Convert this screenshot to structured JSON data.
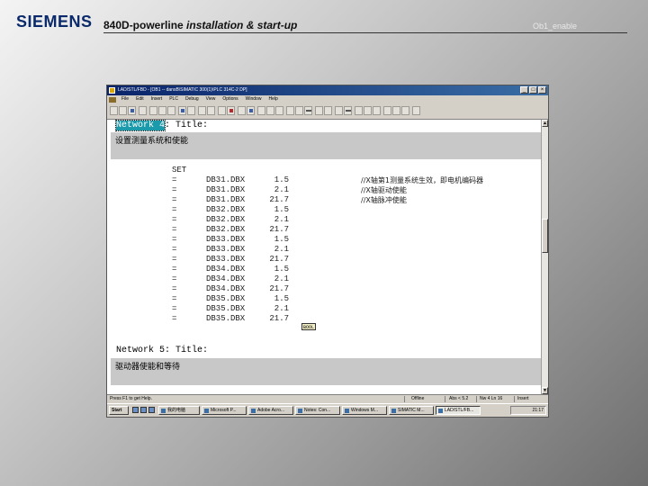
{
  "slide": {
    "logo": "SIEMENS",
    "title_plain": "840D-powerline ",
    "title_italic": "installation & start-up",
    "header_right": "Ob1_enable"
  },
  "window": {
    "title": "LAD/STL/FBD - [OB1 -- dansB\\SIMATIC 300(1)\\PLC 314C-2 DP]",
    "controls": [
      "_",
      "□",
      "×"
    ]
  },
  "menu": [
    "File",
    "Edit",
    "Insert",
    "PLC",
    "Debug",
    "View",
    "Options",
    "Window",
    "Help"
  ],
  "editor": {
    "network4": {
      "label": "Network 4",
      "rest": ": Title:",
      "comment": "设置测量系统和使能"
    },
    "network5": {
      "label": "Network 5",
      "rest": ": Title:",
      "comment": "驱动器使能和等待"
    },
    "rows": [
      {
        "op": "SET",
        "addr": "",
        "bit": "",
        "cmt": ""
      },
      {
        "op": "=",
        "addr": "DB31.DBX",
        "bit": "1.5",
        "cmt": "//X轴第1测量系统生效，即电机编码器"
      },
      {
        "op": "=",
        "addr": "DB31.DBX",
        "bit": "2.1",
        "cmt": "//X轴驱动使能"
      },
      {
        "op": "=",
        "addr": "DB31.DBX",
        "bit": "21.7",
        "cmt": "//X轴脉冲使能"
      },
      {
        "op": "=",
        "addr": "DB32.DBX",
        "bit": "1.5",
        "cmt": ""
      },
      {
        "op": "=",
        "addr": "DB32.DBX",
        "bit": "2.1",
        "cmt": ""
      },
      {
        "op": "=",
        "addr": "DB32.DBX",
        "bit": "21.7",
        "cmt": ""
      },
      {
        "op": "=",
        "addr": "DB33.DBX",
        "bit": "1.5",
        "cmt": ""
      },
      {
        "op": "=",
        "addr": "DB33.DBX",
        "bit": "2.1",
        "cmt": ""
      },
      {
        "op": "=",
        "addr": "DB33.DBX",
        "bit": "21.7",
        "cmt": ""
      },
      {
        "op": "=",
        "addr": "DB34.DBX",
        "bit": "1.5",
        "cmt": ""
      },
      {
        "op": "=",
        "addr": "DB34.DBX",
        "bit": "2.1",
        "cmt": ""
      },
      {
        "op": "=",
        "addr": "DB34.DBX",
        "bit": "21.7",
        "cmt": ""
      },
      {
        "op": "=",
        "addr": "DB35.DBX",
        "bit": "1.5",
        "cmt": ""
      },
      {
        "op": "=",
        "addr": "DB35.DBX",
        "bit": "2.1",
        "cmt": ""
      },
      {
        "op": "=",
        "addr": "DB35.DBX",
        "bit": "21.7",
        "cmt": ""
      }
    ],
    "cursor_box_text": "BOOL"
  },
  "status": {
    "help": "Press F1 to get Help.",
    "mode": "Offline",
    "abs": "Abs < 5.2",
    "line": "Nw 4 Ln 16",
    "ins": "Insert"
  },
  "taskbar": {
    "start": "Start",
    "tasks": [
      "我的电脑",
      "Microsoft P...",
      "Adobe Acro...",
      "Notes: Con...",
      "Windows M...",
      "SIMATIC M...",
      "LAD/STL/FB..."
    ],
    "clock": "21:17"
  }
}
